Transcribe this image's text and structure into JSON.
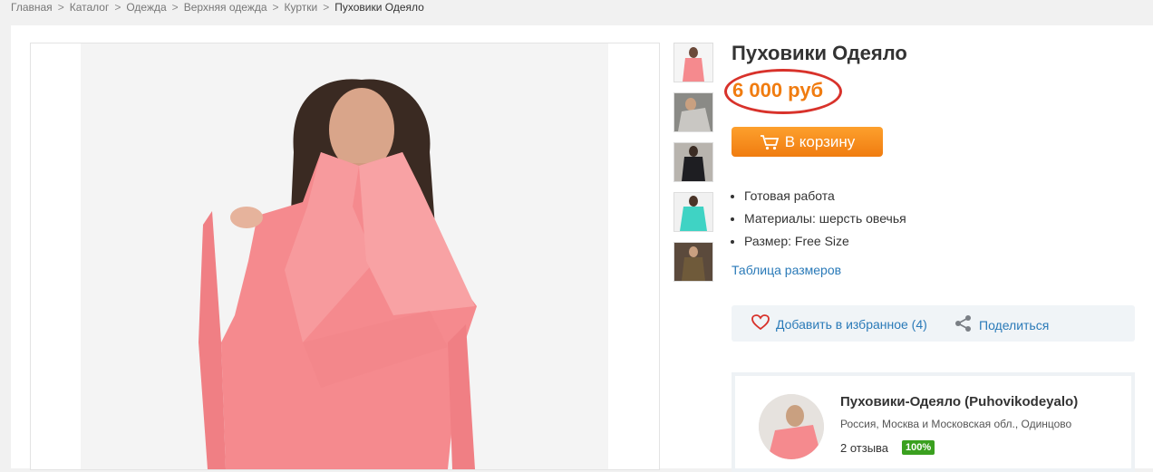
{
  "breadcrumb": {
    "items": [
      "Главная",
      "Каталог",
      "Одежда",
      "Верхняя одежда",
      "Куртки"
    ],
    "current": "Пуховики Одеяло",
    "separator": ">"
  },
  "product": {
    "title": "Пуховики Одеяло",
    "price": "6 000 руб",
    "cart_button": "В корзину",
    "features": [
      "Готовая работа",
      "Материалы:  шерсть овечья",
      "Размер: Free Size"
    ],
    "size_table_link": "Таблица размеров"
  },
  "actions": {
    "favorite": "Добавить в избранное (4)",
    "share": "Поделиться"
  },
  "seller": {
    "name": "Пуховики-Одеяло (Puhovikodeyalo)",
    "location": "Россия, Москва и Московская обл., Одинцово",
    "reviews": "2 отзыва",
    "rating_badge": "100%"
  },
  "colors": {
    "accent": "#f07c10",
    "link": "#2a7ab8",
    "highlight_ring": "#d8322b",
    "badge": "#3aa01f"
  }
}
